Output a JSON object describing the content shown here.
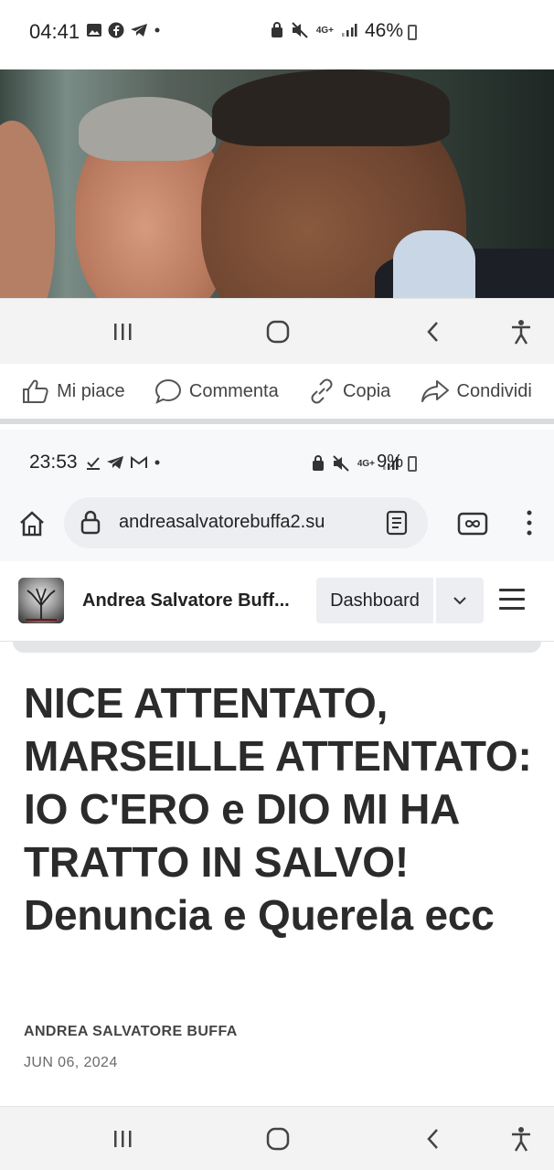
{
  "outer_status": {
    "time": "04:41",
    "battery": "46%",
    "network": "4G+"
  },
  "outer_nav": {
    "recents": "recents",
    "home": "home",
    "back": "back",
    "accessibility": "accessibility"
  },
  "fb_actions": {
    "like": "Mi piace",
    "comment": "Commenta",
    "copy": "Copia",
    "share": "Condividi"
  },
  "inner_status": {
    "time": "23:53",
    "battery": "9%",
    "network": "4G+"
  },
  "browser": {
    "url": "andreasalvatorebuffa2.su"
  },
  "site": {
    "name": "Andrea Salvatore Buff...",
    "dashboard": "Dashboard"
  },
  "article": {
    "title": "NICE ATTENTATO, MARSEILLE ATTENTATO: IO C'ERO e DIO MI HA TRATTO IN SALVO! Denuncia e Querela ecc",
    "author": "ANDREA SALVATORE BUFFA",
    "date": "JUN 06, 2024"
  },
  "colors": {
    "nav_bg": "#f3f3f3",
    "text_dark": "#2b2b2b",
    "url_bg": "#eceef1"
  }
}
